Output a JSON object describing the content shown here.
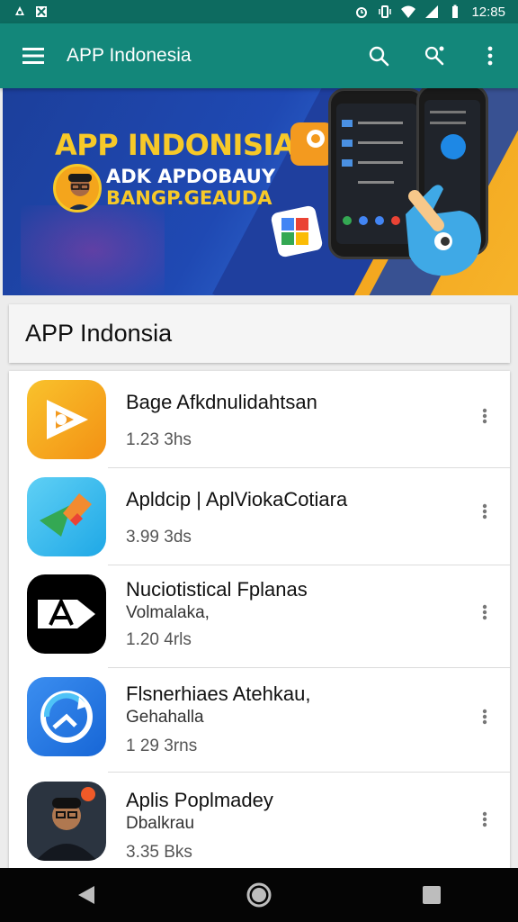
{
  "status_bar": {
    "time": "12:85",
    "left_icons": [
      "sync-icon",
      "photo-icon"
    ],
    "right_icons": [
      "alarm-icon",
      "vibrate-icon",
      "wifi-icon",
      "signal-icon",
      "battery-icon"
    ]
  },
  "app_bar": {
    "title": "APP Indonesia",
    "menu_icon": "hamburger-menu-icon",
    "actions": [
      "search-icon",
      "share-icon",
      "more-vert-icon"
    ]
  },
  "banner": {
    "title": "APP INDONISIA",
    "subtitle_1": "ADK APDOBAUY",
    "subtitle_2": "BANGP.GEAUDA"
  },
  "section": {
    "title": "APP Indonsia"
  },
  "apps": [
    {
      "name": "Bage Afkdnulidahtsan",
      "sub": "",
      "meta": "1.23 3hs",
      "icon": "orange-play-icon",
      "color": "#f5a31a"
    },
    {
      "name": "Apldcip | AplViokaCotiara",
      "sub": "",
      "meta": "3.99 3ds",
      "icon": "colorful-arrow-icon",
      "color": "#29b6f6"
    },
    {
      "name": "Nuciotistical Fplanas",
      "sub": "Volmalaka,",
      "meta": "1.20 4rls",
      "icon": "letter-a-icon",
      "color": "#000000"
    },
    {
      "name": "Flsnerhiaes Atehkau,",
      "sub": "Gehahalla",
      "meta": "1 29 3rns",
      "icon": "refresh-circle-icon",
      "color": "#1e88e5"
    },
    {
      "name": "Aplis Poplmadey",
      "sub": "Dbalkrau",
      "meta": "3.35 Bks",
      "icon": "person-photo-icon",
      "color": "#2b3440"
    }
  ],
  "nav": {
    "back": "back-icon",
    "home": "home-icon",
    "recents": "recents-icon"
  },
  "colors": {
    "status_bar": "#0d6b60",
    "app_bar": "#13877a",
    "accent_yellow": "#f7c928"
  }
}
